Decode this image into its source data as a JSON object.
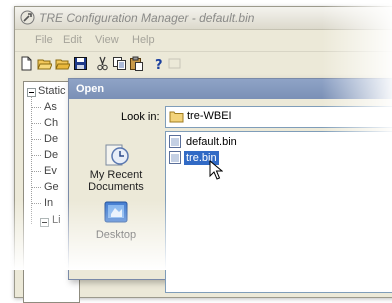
{
  "main_window": {
    "title": "TRE Configuration Manager - default.bin",
    "menu": [
      "File",
      "Edit",
      "View",
      "Help"
    ],
    "toolbar_icons": [
      "new-icon",
      "open-icon",
      "open-folder-icon",
      "save-icon",
      "cut-icon",
      "copy-icon",
      "paste-icon",
      "help-icon",
      "disabled-icon"
    ],
    "tree": {
      "root_label": "Static",
      "children": [
        "As",
        "Ch",
        "De",
        "De",
        "Ev",
        "Ge",
        "In"
      ],
      "second_root_label": "Li"
    }
  },
  "dialog": {
    "title": "Open",
    "look_in_label": "Look in:",
    "look_in_value": "tre-WBEI",
    "places": [
      {
        "label_line1": "My Recent",
        "label_line2": "Documents",
        "icon": "recent-documents-icon"
      },
      {
        "label_line1": "Desktop",
        "label_line2": "",
        "icon": "desktop-icon"
      }
    ],
    "files": [
      {
        "name": "default.bin",
        "selected": false
      },
      {
        "name": "tre.bin",
        "selected": true
      }
    ]
  },
  "colors": {
    "dialog_title_bg": "#7b90b6",
    "selection": "#316ac5",
    "window_bg": "#ece9d8"
  }
}
